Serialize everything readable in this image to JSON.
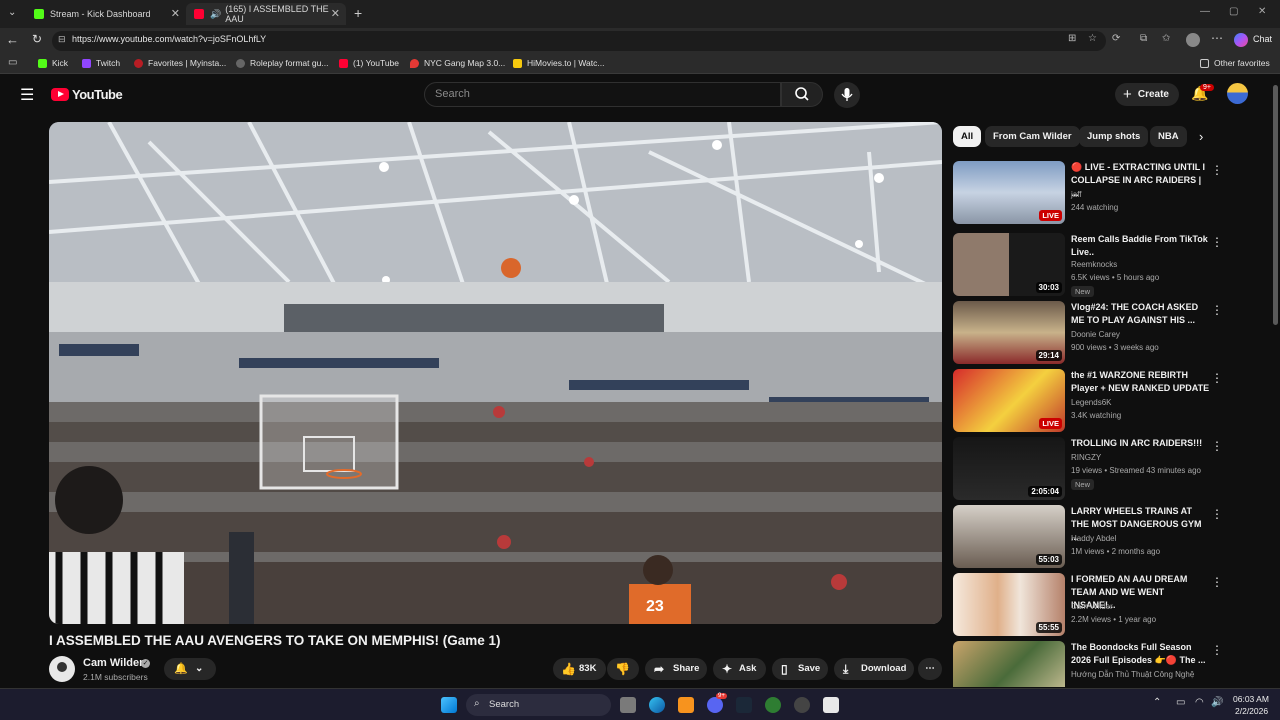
{
  "browser": {
    "tabs": [
      {
        "title": "Stream - Kick Dashboard",
        "active": false
      },
      {
        "title": "(165) I ASSEMBLED THE AAU",
        "active": true
      }
    ],
    "url": "https://www.youtube.com/watch?v=joSFnOLhfLY",
    "chat_label": "Chat",
    "bookmarks": [
      "Kick",
      "Twitch",
      "Favorites | Myinsta...",
      "Roleplay format gu...",
      "(1) YouTube",
      "NYC Gang Map 3.0...",
      "HiMovies.to | Watc..."
    ],
    "other_favorites": "Other favorites"
  },
  "youtube": {
    "logo": "YouTube",
    "search_placeholder": "Search",
    "create_label": "Create",
    "notif_count": "9+",
    "video": {
      "title": "I ASSEMBLED THE AAU AVENGERS TO TAKE ON MEMPHIS! (Game 1)",
      "channel": "Cam Wilder",
      "subscribers": "2.1M subscribers",
      "likes": "83K",
      "share": "Share",
      "ask": "Ask",
      "save": "Save",
      "download": "Download"
    },
    "chips": [
      "All",
      "From Cam Wilder",
      "Jump shots",
      "NBA"
    ],
    "recommendations": [
      {
        "title": "🔴 LIVE - EXTRACTING UNTIL I COLLAPSE IN ARC RAIDERS | ...",
        "channel": "jaff",
        "meta": "244 watching",
        "badge": "LIVE",
        "new": ""
      },
      {
        "title": "Reem Calls Baddie From TikTok Live..",
        "channel": "Reemknocks",
        "meta": "6.5K views • 5 hours ago",
        "badge": "30:03",
        "new": "New"
      },
      {
        "title": "Vlog#24: THE COACH ASKED ME TO PLAY AGAINST HIS ...",
        "channel": "Doonie Carey",
        "meta": "900 views • 3 weeks ago",
        "badge": "29:14",
        "new": ""
      },
      {
        "title": "the #1 WARZONE REBIRTH Player + NEW RANKED UPDATE",
        "channel": "Legends6K",
        "meta": "3.4K watching",
        "badge": "LIVE",
        "new": ""
      },
      {
        "title": "TROLLING IN ARC RAIDERS!!!",
        "channel": "RINGZY",
        "meta": "19 views • Streamed 43 minutes ago",
        "badge": "2:05:04",
        "new": "New"
      },
      {
        "title": "LARRY WHEELS TRAINS AT THE MOST DANGEROUS GYM ...",
        "channel": "Haddy Abdel",
        "meta": "1M views • 2 months ago",
        "badge": "55:03",
        "new": ""
      },
      {
        "title": "I FORMED AN AAU DREAM TEAM AND WE WENT INSANE!...",
        "channel": "Cam Wilder",
        "meta": "2.2M views • 1 year ago",
        "badge": "55:55",
        "new": ""
      },
      {
        "title": "The Boondocks Full Season 2026 Full Episodes 👉🔴 The ...",
        "channel": "Hướng Dẫn Thủ Thuật Công Nghệ",
        "meta": "",
        "badge": "",
        "new": ""
      }
    ]
  },
  "taskbar": {
    "search": "Search",
    "time": "06:03 AM",
    "date": "2/2/2026",
    "discord_badge": "9+"
  },
  "colors": {
    "yt_red": "#ff0033",
    "bg": "#0f0f0f",
    "chip": "#272727"
  }
}
